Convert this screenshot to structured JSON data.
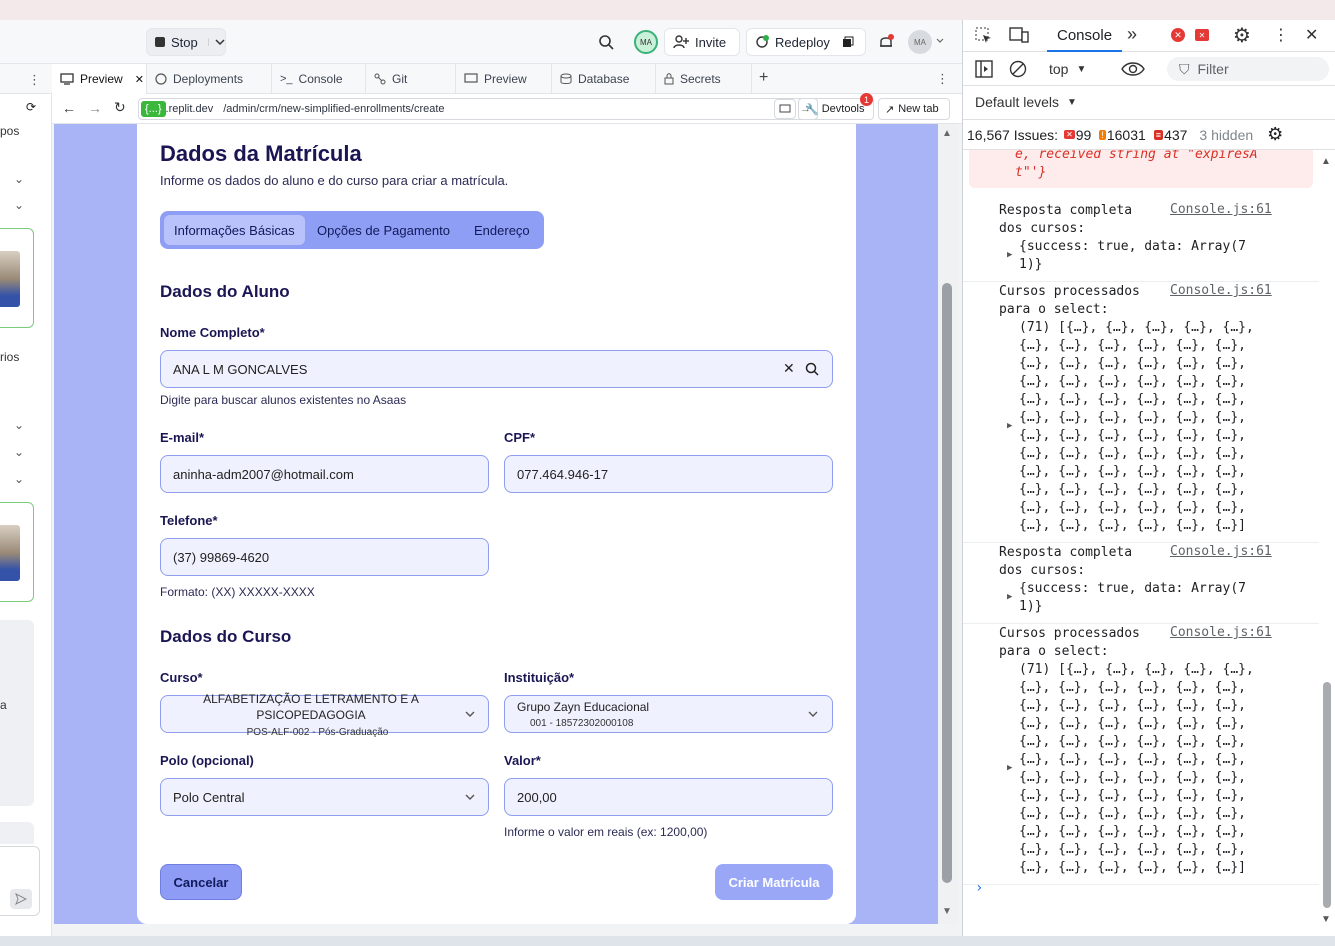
{
  "replit": {
    "stop_label": "Stop",
    "invite_label": "Invite",
    "redeploy_label": "Redeploy",
    "avatar_initials": "MA",
    "tabs": [
      "Preview",
      "Deployments",
      "Console",
      "Git",
      "Preview",
      "Database",
      "Secrets"
    ],
    "url_domain": ".replit.dev",
    "url_chip": "{...}",
    "url_path": "/admin/crm/new-simplified-enrollments/create",
    "devtools_label": "Devtools",
    "devtools_badge": "1",
    "newtab_label": "New tab"
  },
  "left_panel": {
    "text_pos": "pos",
    "text_rios": "rios",
    "text_a": "a"
  },
  "form": {
    "title": "Dados da Matrícula",
    "subtitle": "Informe os dados do aluno e do curso para criar a matrícula.",
    "tabs": [
      "Informações Básicas",
      "Opções de Pagamento",
      "Endereço"
    ],
    "section_student": "Dados do Aluno",
    "name_label": "Nome Completo*",
    "name_value": "ANA L M GONCALVES",
    "name_hint": "Digite para buscar alunos existentes no Asaas",
    "email_label": "E-mail*",
    "email_value": "aninha-adm2007@hotmail.com",
    "cpf_label": "CPF*",
    "cpf_value": "077.464.946-17",
    "phone_label": "Telefone*",
    "phone_value": "(37) 99869-4620",
    "phone_hint": "Formato: (XX) XXXXX-XXXX",
    "section_course": "Dados do Curso",
    "course_label": "Curso*",
    "course_line1": "ALFABETIZAÇÃO E LETRAMENTO E A",
    "course_line2": "PSICOPEDAGOGIA",
    "course_line3": "POS-ALF-002 - Pós-Graduação",
    "institution_label": "Instituição*",
    "institution_name": "Grupo Zayn Educacional",
    "institution_code": "001 - 18572302000108",
    "polo_label": "Polo (opcional)",
    "polo_value": "Polo Central",
    "value_label": "Valor*",
    "value_value": "200,00",
    "value_hint": "Informe o valor em reais (ex: 1200,00)",
    "cancel_label": "Cancelar",
    "create_label": "Criar Matrícula"
  },
  "devtools": {
    "console_tab": "Console",
    "context": "top",
    "filter_placeholder": "Filter",
    "levels": "Default levels",
    "issues_total": "16,567 Issues:",
    "issues_errors": "99",
    "issues_warnings": "16031",
    "issues_info": "437",
    "hidden": "3 hidden",
    "error_text": "e, received string at \"expiresA\nt\"'}",
    "messages": [
      {
        "text": "Resposta completa\ndos cursos:",
        "src": "Console.js:61",
        "obj": "{success: true, data: Array(7\n1)}"
      },
      {
        "text": "Cursos processados\npara o select:",
        "src": "Console.js:61",
        "obj": "(71) [{…}, {…}, {…}, {…}, {…},\n{…}, {…}, {…}, {…}, {…}, {…},\n{…}, {…}, {…}, {…}, {…}, {…},\n{…}, {…}, {…}, {…}, {…}, {…},\n{…}, {…}, {…}, {…}, {…}, {…},\n{…}, {…}, {…}, {…}, {…}, {…},\n{…}, {…}, {…}, {…}, {…}, {…},\n{…}, {…}, {…}, {…}, {…}, {…},\n{…}, {…}, {…}, {…}, {…}, {…},\n{…}, {…}, {…}, {…}, {…}, {…},\n{…}, {…}, {…}, {…}, {…}, {…},\n{…}, {…}, {…}, {…}, {…}, {…}]"
      },
      {
        "text": "Resposta completa\ndos cursos:",
        "src": "Console.js:61",
        "obj": "{success: true, data: Array(7\n1)}"
      },
      {
        "text": "Cursos processados\npara o select:",
        "src": "Console.js:61",
        "obj": "(71) [{…}, {…}, {…}, {…}, {…},\n{…}, {…}, {…}, {…}, {…}, {…},\n{…}, {…}, {…}, {…}, {…}, {…},\n{…}, {…}, {…}, {…}, {…}, {…},\n{…}, {…}, {…}, {…}, {…}, {…},\n{…}, {…}, {…}, {…}, {…}, {…},\n{…}, {…}, {…}, {…}, {…}, {…},\n{…}, {…}, {…}, {…}, {…}, {…},\n{…}, {…}, {…}, {…}, {…}, {…},\n{…}, {…}, {…}, {…}, {…}, {…},\n{…}, {…}, {…}, {…}, {…}, {…},\n{…}, {…}, {…}, {…}, {…}, {…}]"
      }
    ]
  },
  "colors": {
    "accent": "#8f9ef5",
    "preview_bg": "#a9b4f7",
    "heading": "#1a1654",
    "error": "#d93025"
  }
}
